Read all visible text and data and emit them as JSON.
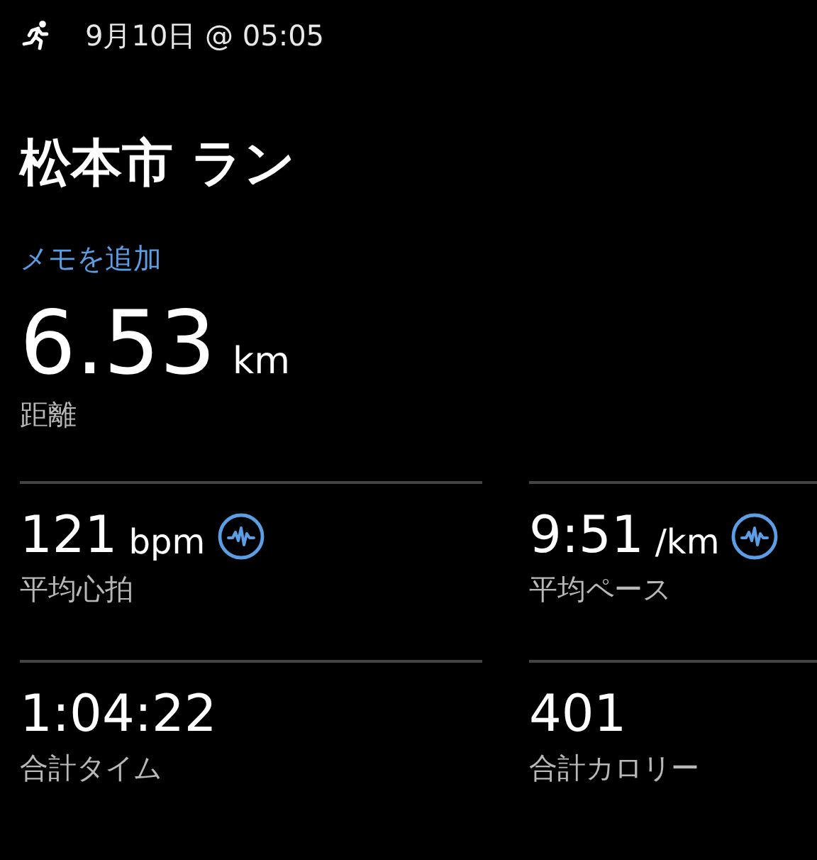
{
  "header": {
    "date": "9月10日 @ 05:05"
  },
  "title": "松本市 ラン",
  "memo_link": "メモを追加",
  "distance": {
    "value": "6.53",
    "unit": "km",
    "label": "距離"
  },
  "stats": [
    {
      "value": "121",
      "unit": "bpm",
      "label": "平均心拍",
      "analysis_button": true
    },
    {
      "value": "9:51",
      "unit": "/km",
      "label": "平均ペース",
      "analysis_button": true
    },
    {
      "value": "1:04:22",
      "label": "合計タイム",
      "analysis_button": false
    },
    {
      "value": "401",
      "label": "合計カロリー",
      "analysis_button": false
    }
  ]
}
